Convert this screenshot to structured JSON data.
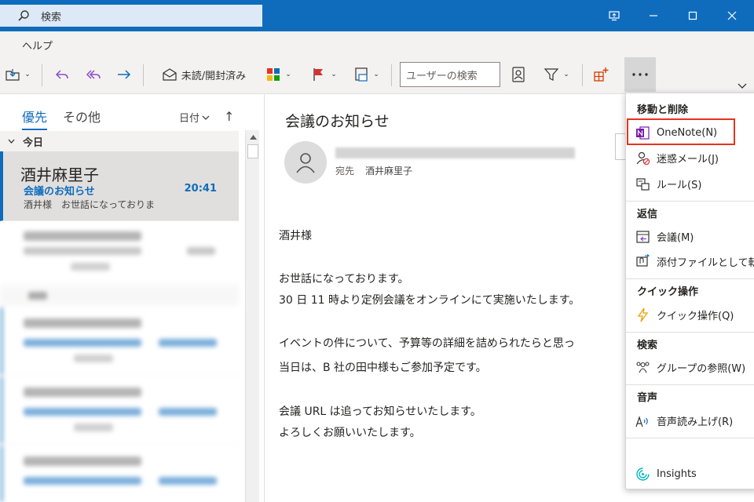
{
  "titlebar": {
    "search_placeholder": "検索"
  },
  "menubar": {
    "help": "ヘルプ"
  },
  "ribbon": {
    "read_unread": "未読/開封済み",
    "people_search_placeholder": "ユーザーの検索"
  },
  "list": {
    "tabs": {
      "focused": "優先",
      "other": "その他"
    },
    "sort_label": "日付",
    "group_today": "今日",
    "selected": {
      "sender": "酒井麻里子",
      "subject": "会議のお知らせ",
      "time": "20:41",
      "preview": "酒井様　お世話になっておりま"
    }
  },
  "reading": {
    "subject": "会議のお知らせ",
    "to_label": "宛先",
    "to_name": "酒井麻里子",
    "body": [
      "酒井様",
      "お世話になっております。",
      "30 日 11 時より定例会議をオンラインにて実施いたします。",
      "イベントの件について、予算等の詳細を詰められたらと思っ",
      "当日は、B 社の田中様もご参加予定です。",
      "会議 URL は追ってお知らせいたします。",
      "よろしくお願いいたします。"
    ]
  },
  "dropdown": {
    "sections": {
      "move_delete": "移動と削除",
      "reply": "返信",
      "quick": "クイック操作",
      "search": "検索",
      "voice": "音声"
    },
    "items": {
      "onenote": "OneNote(N)",
      "junk": "迷惑メール(J)",
      "rules": "ルール(S)",
      "meeting": "会議(M)",
      "forward_attach": "添付ファイルとして転送(",
      "quick_steps": "クイック操作(Q)",
      "group_browse": "グループの参照(W)",
      "read_aloud": "音声読み上げ(R)",
      "insights": "Insights"
    }
  },
  "colors": {
    "accent": "#0f6cbd",
    "highlight": "#e8321e",
    "onenote": "#7719aa"
  }
}
